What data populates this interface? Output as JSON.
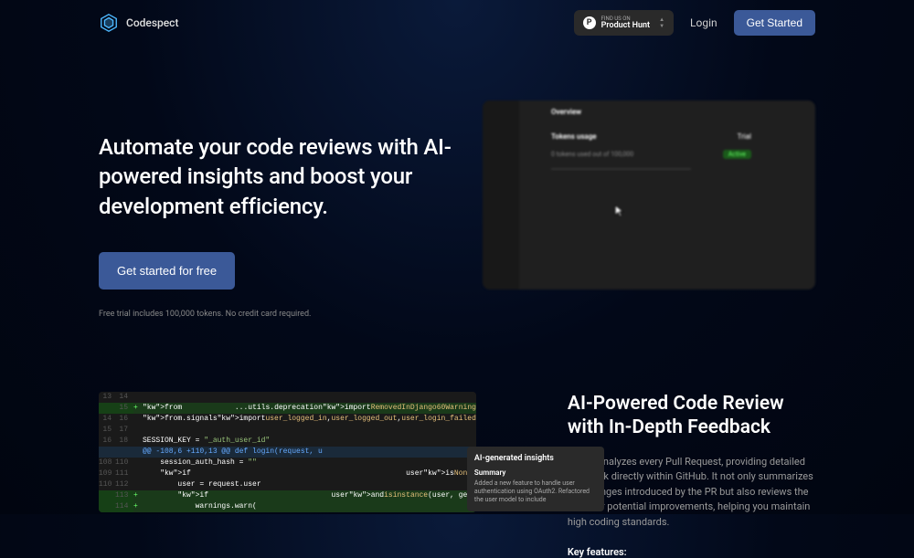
{
  "header": {
    "brand": "Codespect",
    "product_hunt": {
      "top": "Find us on",
      "bottom": "Product Hunt"
    },
    "login": "Login",
    "get_started": "Get Started"
  },
  "hero": {
    "title": "Automate your code reviews with AI-powered insights and boost your development efficiency.",
    "cta": "Get started for free",
    "subtext": "Free trial includes 100,000 tokens. No credit card required."
  },
  "preview": {
    "overview": "Overview",
    "tokens_usage": "Tokens usage",
    "trial": "Trial",
    "usage_text": "0 tokens used out of 100,000",
    "active": "Active"
  },
  "feature": {
    "title_line1": "AI-Powered Code Review",
    "title_line2": "with In-Depth Feedback",
    "description": "Our AI analyzes every Pull Request, providing detailed feedback directly within GitHub. It not only summarizes the changes introduced by the PR but also reviews the code for potential improvements, helping you maintain high coding standards.",
    "key_heading": "Key features:"
  },
  "code": {
    "lines": [
      {
        "n1": "13",
        "n2": "14",
        "cls": "ctx",
        "text": ""
      },
      {
        "n1": "",
        "n2": "15",
        "cls": "add",
        "text": "from ...utils.deprecation import RemovedInDjango60Warning"
      },
      {
        "n1": "14",
        "n2": "16",
        "cls": "ctx",
        "text": "from .signals import user_logged_in, user_logged_out, user_login_failed"
      },
      {
        "n1": "15",
        "n2": "17",
        "cls": "ctx",
        "text": ""
      },
      {
        "n1": "16",
        "n2": "18",
        "cls": "ctx",
        "text": "SESSION_KEY = \"_auth_user_id\""
      },
      {
        "n1": "",
        "n2": "",
        "cls": "hunk",
        "text": "@@ -108,6 +110,13 @@ def login(request, u"
      },
      {
        "n1": "108",
        "n2": "110",
        "cls": "ctx",
        "text": "    session_auth_hash = \"\""
      },
      {
        "n1": "109",
        "n2": "111",
        "cls": "ctx",
        "text": "    if user is None:"
      },
      {
        "n1": "110",
        "n2": "112",
        "cls": "ctx",
        "text": "        user = request.user"
      },
      {
        "n1": "",
        "n2": "113",
        "cls": "add",
        "text": "        if user and isinstance(user, get_"
      },
      {
        "n1": "",
        "n2": "114",
        "cls": "add",
        "text": "            warnings.warn("
      }
    ]
  },
  "insight": {
    "title": "AI-generated insights",
    "summary_label": "Summary",
    "body": "Added a new feature to handle user authentication using OAuth2. Refactored the user model to include"
  }
}
